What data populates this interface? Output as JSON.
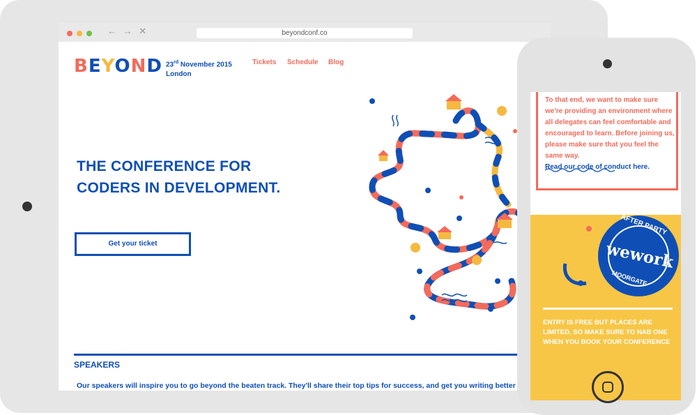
{
  "browser": {
    "url": "beyondconf.co",
    "nav_arrows": "← → ✕"
  },
  "header": {
    "logo": [
      "B",
      "E",
      "Y",
      "O",
      "N",
      "D"
    ],
    "date_day": "23",
    "date_suffix": "rd",
    "date_rest": " November 2015",
    "city": "London",
    "nav": [
      "Tickets",
      "Schedule",
      "Blog"
    ]
  },
  "hero": {
    "title_line1": "THE CONFERENCE FOR",
    "title_line2": "CODERS IN DEVELOPMENT.",
    "cta": "Get your ticket"
  },
  "speakers": {
    "heading": "SPEAKERS",
    "description": "Our speakers will inspire you to go beyond the beaten track. They'll share their top tips for success, and get you writing better code."
  },
  "phone": {
    "code_text": "To that end, we want to make sure we're providing an environment where all delegates can feel comfortable and encouraged to learn. Before joining us, please make sure that you feel the same way.",
    "code_link": "Read our code of conduct here.",
    "badge_top": "AFTER PARTY",
    "badge_brand": "wework",
    "badge_bottom": "MOORGATE",
    "entry_text": "ENTRY IS FREE BUT PLACES ARE LIMITED, SO MAKE SURE TO NAB ONE WHEN YOU BOOK YOUR CONFERENCE"
  },
  "colors": {
    "brand_blue": "#0f4fb5",
    "coral": "#f26b5b",
    "yellow": "#f8c646",
    "frame_grey": "#e6e6e6"
  },
  "icons": [
    "close-dot-icon",
    "minimize-dot-icon",
    "maximize-dot-icon",
    "home-button-icon",
    "wework-badge-icon"
  ]
}
